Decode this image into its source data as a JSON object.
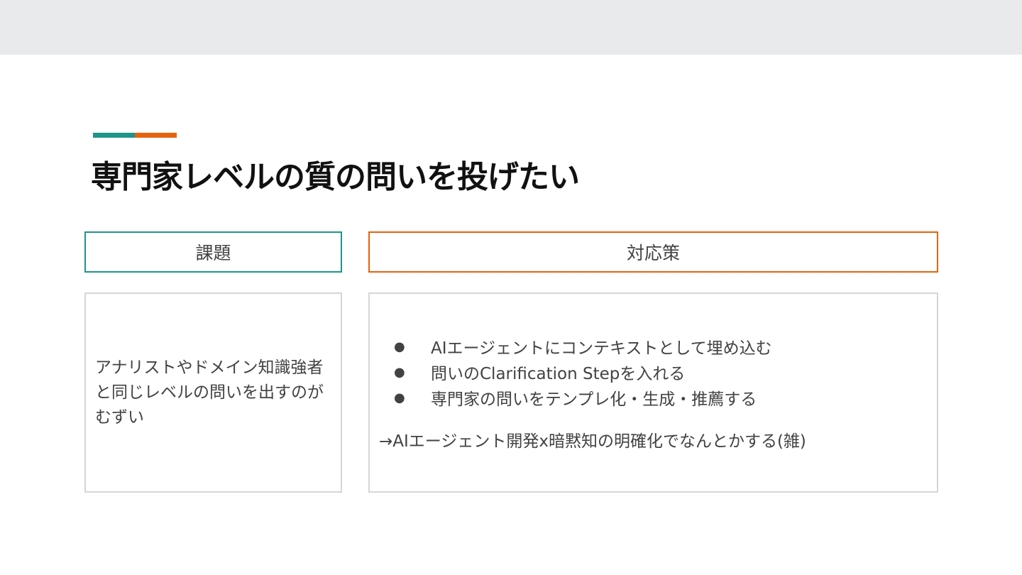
{
  "slide": {
    "title": "専門家レベルの質の問いを投げたい",
    "colors": {
      "teal": "#1f9488",
      "orange": "#e5620e",
      "top_band": "#e8eaeb",
      "box_border": "#d6d6d6",
      "text": "#424242"
    }
  },
  "issue": {
    "header": "課題",
    "text": "アナリストやドメイン知識強者と同じレベルの問いを出すのがむずい"
  },
  "solution": {
    "header": "対応策",
    "bullet_symbol": "●",
    "bullets": [
      "AIエージェントにコンテキストとして埋め込む",
      "問いのClarification Stepを入れる",
      "専門家の問いをテンプレ化・生成・推薦する"
    ],
    "conclusion": "→AIエージェント開発x暗黙知の明確化でなんとかする(雑)"
  }
}
